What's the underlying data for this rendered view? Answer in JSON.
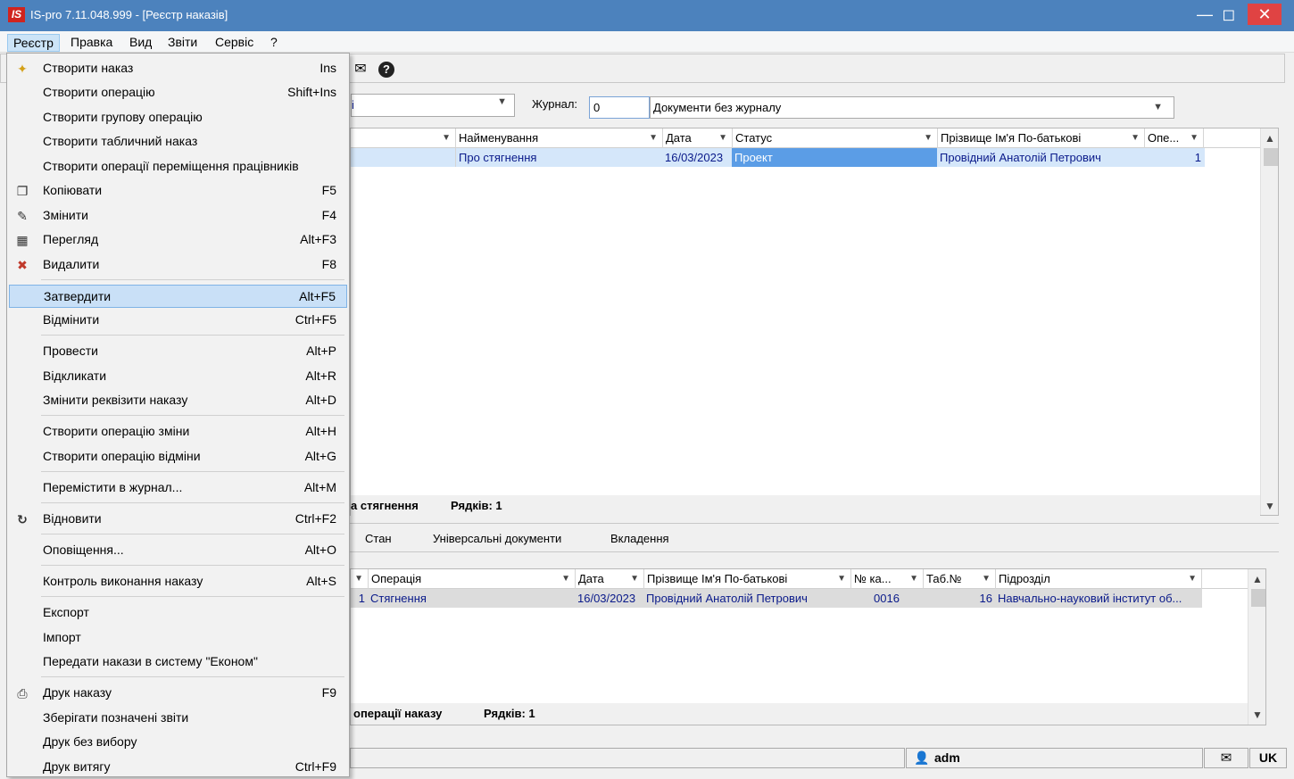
{
  "window": {
    "title": "IS-pro 7.11.048.999 - [Реєстр наказів]",
    "logo": "IS"
  },
  "menubar": [
    "Реєстр",
    "Правка",
    "Вид",
    "Звіти",
    "Сервіс",
    "?"
  ],
  "toolbar": {
    "icons": [
      "mail-icon",
      "help-icon"
    ]
  },
  "filter": {
    "left_combo_value": "і",
    "journal_label": "Журнал:",
    "journal_code": "0",
    "journal_name": "Документи без журналу"
  },
  "top_grid": {
    "headers": [
      "Найменування",
      "Дата",
      "Статус",
      "Прізвище Ім'я По-батькові",
      "Опе..."
    ],
    "row": {
      "name": "Про стягнення",
      "date": "16/03/2023",
      "status": "Проект",
      "person": "Провідний Анатолій Петрович",
      "ops": "1"
    },
    "footer_title": "а стягнення",
    "footer_rows": "Рядків: 1"
  },
  "tabs": [
    "Стан",
    "Універсальні документи",
    "Вкладення"
  ],
  "bottom_grid": {
    "headers": [
      "Операція",
      "Дата",
      "Прізвище Ім'я По-батькові",
      "№ ка...",
      "Таб.№",
      "Підрозділ"
    ],
    "row": {
      "num": "1",
      "operation": "Стягнення",
      "date": "16/03/2023",
      "person": "Провідний Анатолій Петрович",
      "card": "0016",
      "tab": "16",
      "dept": "Навчально-науковий інститут об..."
    },
    "footer_title": "операції наказу",
    "footer_rows": "Рядків: 1"
  },
  "statusbar": {
    "user": "adm",
    "lang": "UK"
  },
  "dropdown": [
    {
      "label": "Створити наказ",
      "shortcut": "Ins",
      "icon": "new-order-icon"
    },
    {
      "label": "Створити операцію",
      "shortcut": "Shift+Ins"
    },
    {
      "label": "Створити групову операцію",
      "shortcut": ""
    },
    {
      "label": "Створити табличний наказ",
      "shortcut": ""
    },
    {
      "label": "Створити операції переміщення працівників",
      "shortcut": ""
    },
    {
      "label": "Копіювати",
      "shortcut": "F5",
      "icon": "copy-icon"
    },
    {
      "label": "Змінити",
      "shortcut": "F4",
      "icon": "edit-icon"
    },
    {
      "label": "Перегляд",
      "shortcut": "Alt+F3",
      "icon": "table-view-icon"
    },
    {
      "label": "Видалити",
      "shortcut": "F8",
      "icon": "delete-icon"
    },
    {
      "label": "Затвердити",
      "shortcut": "Alt+F5"
    },
    {
      "label": "Відмінити",
      "shortcut": "Ctrl+F5"
    },
    {
      "label": "Провести",
      "shortcut": "Alt+P"
    },
    {
      "label": "Відкликати",
      "shortcut": "Alt+R"
    },
    {
      "label": "Змінити реквізити наказу",
      "shortcut": "Alt+D"
    },
    {
      "label": "Створити операцію зміни",
      "shortcut": "Alt+H"
    },
    {
      "label": "Створити операцію відміни",
      "shortcut": "Alt+G"
    },
    {
      "label": "Перемістити в журнал...",
      "shortcut": "Alt+M"
    },
    {
      "label": "Відновити",
      "shortcut": "Ctrl+F2",
      "icon": "refresh-icon"
    },
    {
      "label": "Оповіщення...",
      "shortcut": "Alt+O"
    },
    {
      "label": "Контроль виконання наказу",
      "shortcut": "Alt+S"
    },
    {
      "label": "Експорт",
      "shortcut": ""
    },
    {
      "label": "Імпорт",
      "shortcut": ""
    },
    {
      "label": "Передати накази в систему \"Економ\"",
      "shortcut": ""
    },
    {
      "label": "Друк наказу",
      "shortcut": "F9",
      "icon": "print-icon"
    },
    {
      "label": "Зберігати позначені звіти",
      "shortcut": ""
    },
    {
      "label": "Друк без вибору",
      "shortcut": ""
    },
    {
      "label": "Друк витягу",
      "shortcut": "Ctrl+F9"
    }
  ]
}
